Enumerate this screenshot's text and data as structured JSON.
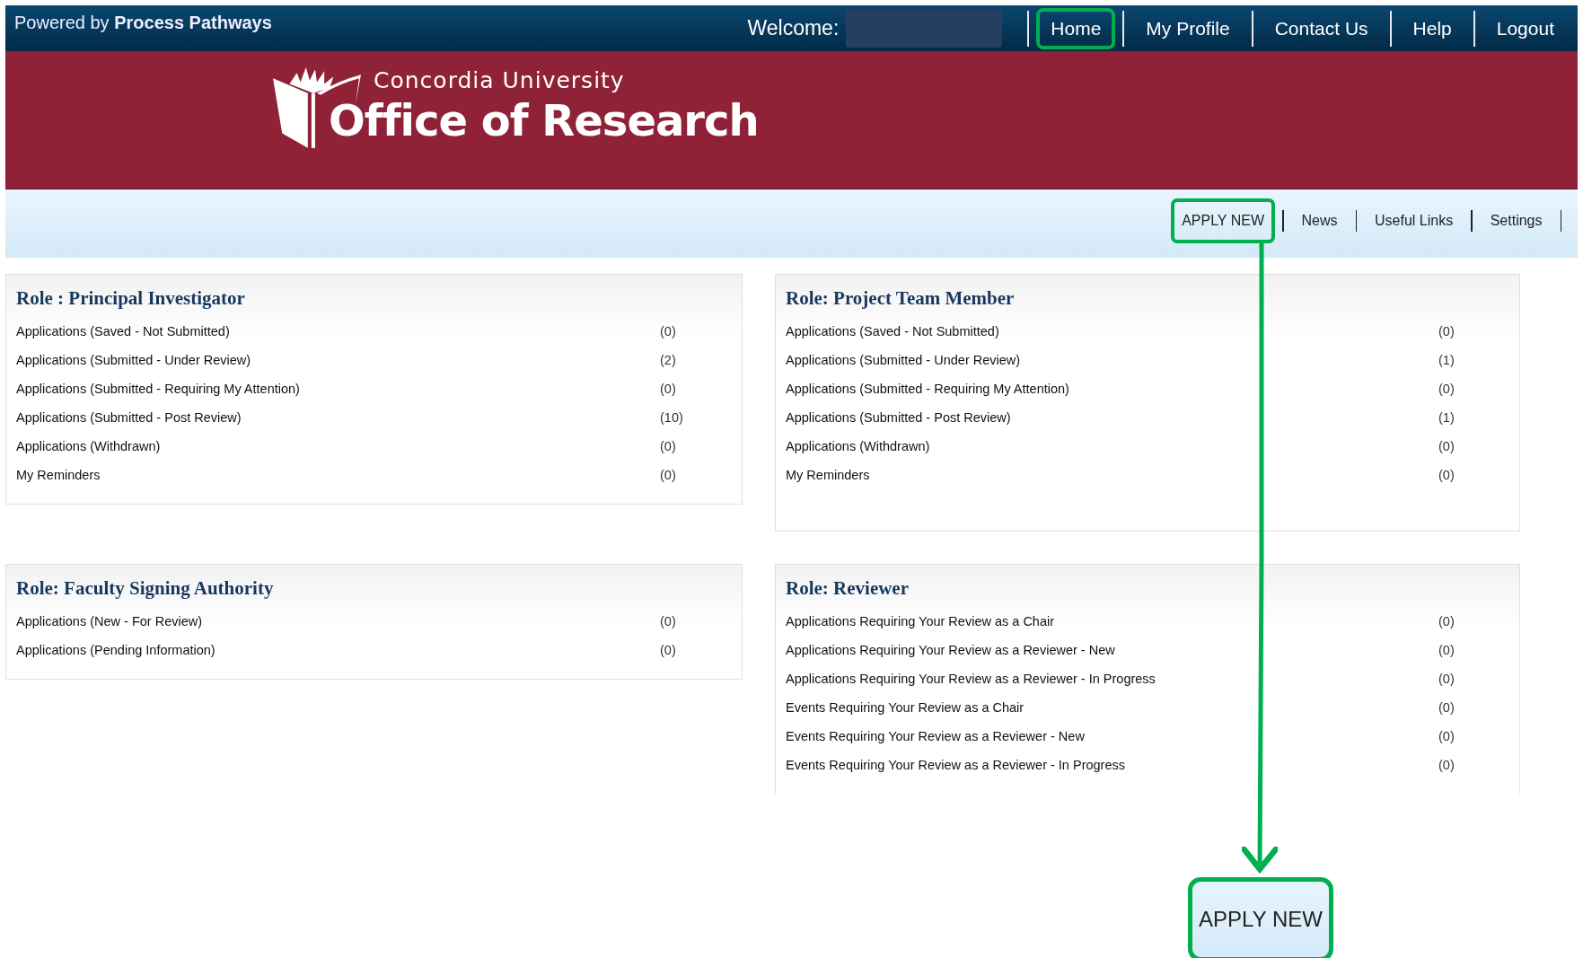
{
  "top_bar": {
    "powered_by": "Powered by **Process Pathways**",
    "welcome_label": "Welcome:",
    "nav": [
      {
        "label": "Home",
        "highlighted": true
      },
      {
        "label": "My Profile",
        "highlighted": false
      },
      {
        "label": "Contact Us",
        "highlighted": false
      },
      {
        "label": "Help",
        "highlighted": false
      },
      {
        "label": "Logout",
        "highlighted": false
      }
    ]
  },
  "banner": {
    "university": "Concordia University",
    "office": "Office of Research"
  },
  "sub_nav": [
    {
      "label": "APPLY NEW",
      "highlighted": true
    },
    {
      "label": "News",
      "highlighted": false
    },
    {
      "label": "Useful Links",
      "highlighted": false
    },
    {
      "label": "Settings",
      "highlighted": false
    }
  ],
  "panels": [
    {
      "title": "Role : Principal Investigator",
      "rows": [
        {
          "label": "Applications (Saved - Not Submitted)",
          "count": "(0)"
        },
        {
          "label": "Applications (Submitted - Under Review)",
          "count": "(2)"
        },
        {
          "label": "Applications (Submitted - Requiring My Attention)",
          "count": "(0)"
        },
        {
          "label": "Applications (Submitted - Post Review)",
          "count": "(10)"
        },
        {
          "label": "Applications (Withdrawn)",
          "count": "(0)"
        },
        {
          "label": "My Reminders",
          "count": "(0)"
        }
      ]
    },
    {
      "title": "Role: Project Team Member",
      "rows": [
        {
          "label": "Applications (Saved - Not Submitted)",
          "count": "(0)"
        },
        {
          "label": "Applications (Submitted - Under Review)",
          "count": "(1)"
        },
        {
          "label": "Applications (Submitted - Requiring My Attention)",
          "count": "(0)"
        },
        {
          "label": "Applications (Submitted - Post Review)",
          "count": "(1)"
        },
        {
          "label": "Applications (Withdrawn)",
          "count": "(0)"
        },
        {
          "label": "My Reminders",
          "count": "(0)"
        }
      ]
    },
    {
      "title": "Role: Faculty Signing Authority",
      "rows": [
        {
          "label": "Applications (New - For Review)",
          "count": "(0)"
        },
        {
          "label": "Applications (Pending Information)",
          "count": "(0)"
        }
      ]
    },
    {
      "title": "Role: Reviewer",
      "rows": [
        {
          "label": "Applications Requiring Your Review as a Chair",
          "count": "(0)"
        },
        {
          "label": "Applications Requiring Your Review as a Reviewer - New",
          "count": "(0)"
        },
        {
          "label": "Applications Requiring Your Review as a Reviewer - In Progress",
          "count": "(0)"
        },
        {
          "label": "Events Requiring Your Review as a Chair",
          "count": "(0)"
        },
        {
          "label": "Events Requiring Your Review as a Reviewer - New",
          "count": "(0)"
        },
        {
          "label": "Events Requiring Your Review as a Reviewer - In Progress",
          "count": "(0)"
        }
      ]
    }
  ],
  "callout": {
    "text": "APPLY NEW"
  }
}
